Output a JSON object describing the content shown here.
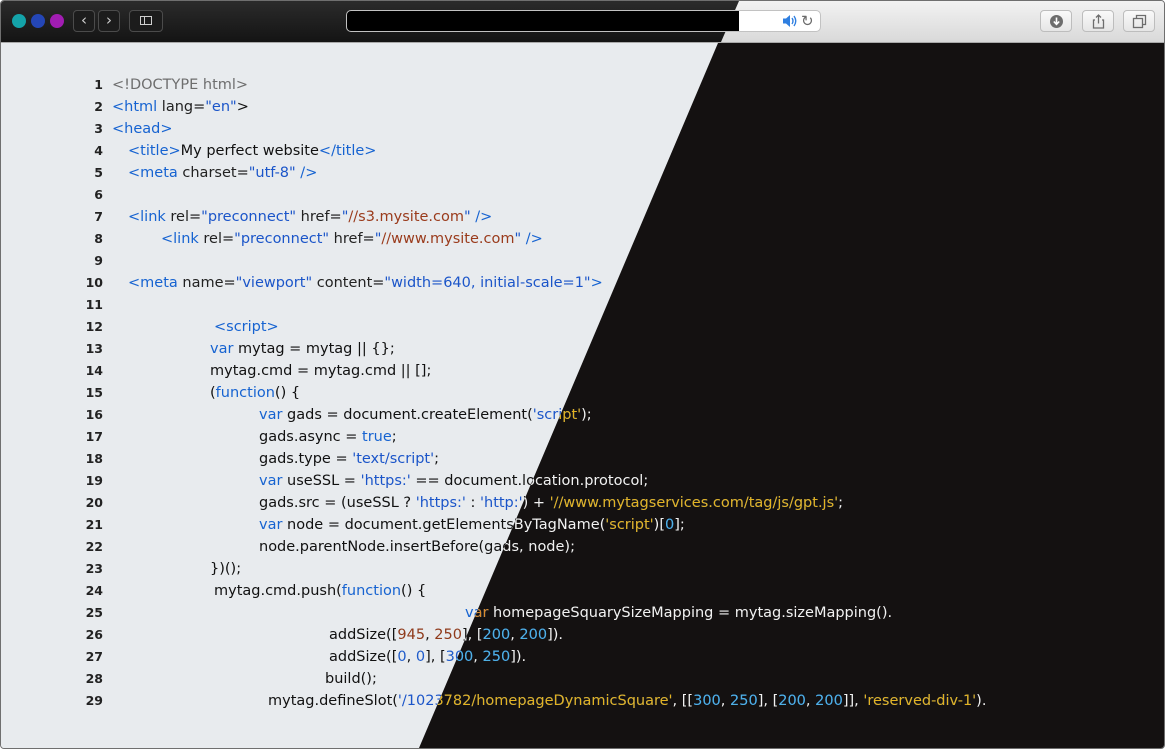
{
  "toolbar": {
    "traffic_lights": [
      {
        "name": "close",
        "color": "#14a3a9"
      },
      {
        "name": "minimize",
        "color": "#2446b6"
      },
      {
        "name": "zoom",
        "color": "#a21db3"
      }
    ],
    "back_glyph": "‹",
    "forward_glyph": "›",
    "reload_glyph": "↻",
    "icons": [
      "sidebar-icon",
      "speaker-icon",
      "reload-icon",
      "download-icon",
      "share-icon",
      "tabs-icon"
    ]
  },
  "theme": {
    "light_background": "#e8ebee",
    "dark_background": "#141111"
  },
  "code_lines": [
    {
      "num": "1",
      "indent": 111,
      "tokens": [
        [
          "c-doc",
          "<!DOCTYPE html>"
        ]
      ]
    },
    {
      "num": "2",
      "indent": 111,
      "tokens": [
        [
          "c-tag",
          "<html"
        ],
        [
          "c-attr",
          " lang"
        ],
        [
          "c-pun",
          "="
        ],
        [
          "c-val",
          "\"en\""
        ],
        [
          "c-pun",
          ">"
        ]
      ]
    },
    {
      "num": "3",
      "indent": 111,
      "tokens": [
        [
          "c-tag",
          "<head>"
        ]
      ]
    },
    {
      "num": "4",
      "indent": 127,
      "tokens": [
        [
          "c-tag",
          "<title>"
        ],
        [
          "c-txt",
          "My perfect website"
        ],
        [
          "c-tag",
          "</title>"
        ]
      ]
    },
    {
      "num": "5",
      "indent": 127,
      "tokens": [
        [
          "c-tag",
          "<meta"
        ],
        [
          "c-attr",
          " charset"
        ],
        [
          "c-pun",
          "="
        ],
        [
          "c-val",
          "\"utf-8\""
        ],
        [
          "c-tag",
          " />"
        ]
      ]
    },
    {
      "num": "6",
      "indent": 127,
      "tokens": []
    },
    {
      "num": "7",
      "indent": 127,
      "tokens": [
        [
          "c-tag",
          "<link"
        ],
        [
          "c-attr",
          " rel"
        ],
        [
          "c-pun",
          "="
        ],
        [
          "c-val",
          "\"preconnect\""
        ],
        [
          "c-attr",
          " href"
        ],
        [
          "c-pun",
          "="
        ],
        [
          "c-val",
          "\""
        ],
        [
          "c-url",
          "//s3.mysite.com"
        ],
        [
          "c-val",
          "\""
        ],
        [
          "c-tag",
          " />"
        ]
      ]
    },
    {
      "num": "8",
      "indent": 160,
      "tokens": [
        [
          "c-tag",
          "<link"
        ],
        [
          "c-attr",
          " rel"
        ],
        [
          "c-pun",
          "="
        ],
        [
          "c-val",
          "\"preconnect\""
        ],
        [
          "c-attr",
          " href"
        ],
        [
          "c-pun",
          "="
        ],
        [
          "c-val",
          "\""
        ],
        [
          "c-url",
          "//www.mysite.com"
        ],
        [
          "c-val",
          "\""
        ],
        [
          "c-tag",
          " />"
        ]
      ]
    },
    {
      "num": "9",
      "indent": 127,
      "tokens": []
    },
    {
      "num": "10",
      "indent": 127,
      "tokens": [
        [
          "c-tag",
          "<meta"
        ],
        [
          "c-attr",
          " name"
        ],
        [
          "c-pun",
          "="
        ],
        [
          "c-val",
          "\"viewport\""
        ],
        [
          "c-attr",
          " content"
        ],
        [
          "c-pun",
          "="
        ],
        [
          "c-val",
          "\"width=640, initial-scale=1\""
        ],
        [
          "c-tag",
          ">"
        ]
      ]
    },
    {
      "num": "11",
      "indent": 127,
      "tokens": []
    },
    {
      "num": "12",
      "indent": 213,
      "tokens": [
        [
          "c-tag",
          "<script>"
        ]
      ]
    },
    {
      "num": "13",
      "indent": 209,
      "tokens": [
        [
          "c-kw",
          "var"
        ],
        [
          "c-txt",
          " mytag = mytag || {};"
        ]
      ]
    },
    {
      "num": "14",
      "indent": 209,
      "tokens": [
        [
          "c-txt",
          "mytag.cmd = mytag.cmd || [];"
        ]
      ]
    },
    {
      "num": "15",
      "indent": 209,
      "tokens": [
        [
          "c-txt",
          "("
        ],
        [
          "c-kw",
          "function"
        ],
        [
          "c-txt",
          "() {"
        ]
      ]
    },
    {
      "num": "16",
      "indent": 258,
      "tokens": [
        [
          "c-kw",
          "var"
        ],
        [
          "c-txt",
          " gads = document.createElement("
        ],
        [
          "c-str",
          "'script'"
        ],
        [
          "c-txt",
          ");"
        ]
      ]
    },
    {
      "num": "17",
      "indent": 258,
      "tokens": [
        [
          "c-txt",
          "gads.async = "
        ],
        [
          "c-kw",
          "true"
        ],
        [
          "c-txt",
          ";"
        ]
      ]
    },
    {
      "num": "18",
      "indent": 258,
      "tokens": [
        [
          "c-txt",
          "gads.type = "
        ],
        [
          "c-str",
          "'text/script'"
        ],
        [
          "c-txt",
          ";"
        ]
      ]
    },
    {
      "num": "19",
      "indent": 258,
      "tokens": [
        [
          "c-kw",
          "var"
        ],
        [
          "c-txt",
          " useSSL = "
        ],
        [
          "c-str",
          "'https:'"
        ],
        [
          "c-txt",
          " == document.location.protocol;"
        ]
      ]
    },
    {
      "num": "20",
      "indent": 258,
      "tokens": [
        [
          "c-txt",
          "gads.src = (useSSL ? "
        ],
        [
          "c-str",
          "'https:'"
        ],
        [
          "c-txt",
          " : "
        ],
        [
          "c-str",
          "'http:'"
        ],
        [
          "c-txt",
          ") + "
        ],
        [
          "c-str",
          "'//www.mytagservices.com/tag/js/gpt.js'"
        ],
        [
          "c-txt",
          ";"
        ]
      ]
    },
    {
      "num": "21",
      "indent": 258,
      "tokens": [
        [
          "c-kw",
          "var"
        ],
        [
          "c-txt",
          " node = document.getElementsByTagName("
        ],
        [
          "c-str",
          "'script'"
        ],
        [
          "c-txt",
          ")["
        ],
        [
          "c-num2",
          "0"
        ],
        [
          "c-txt",
          "];"
        ]
      ]
    },
    {
      "num": "22",
      "indent": 258,
      "tokens": [
        [
          "c-txt",
          "node.parentNode.insertBefore(gads, node);"
        ]
      ]
    },
    {
      "num": "23",
      "indent": 209,
      "tokens": [
        [
          "c-txt",
          "})();"
        ]
      ]
    },
    {
      "num": "24",
      "indent": 213,
      "tokens": [
        [
          "c-txt",
          "mytag.cmd.push("
        ],
        [
          "c-kw",
          "function"
        ],
        [
          "c-txt",
          "() {"
        ]
      ]
    },
    {
      "num": "25",
      "indent": 464,
      "tokens": [
        [
          "c-kw",
          "var"
        ],
        [
          "c-txt",
          " homepageSquarySizeMapping = mytag.sizeMapping()."
        ]
      ]
    },
    {
      "num": "26",
      "indent": 328,
      "tokens": [
        [
          "c-txt",
          "addSize(["
        ],
        [
          "c-num",
          "945"
        ],
        [
          "c-txt",
          ", "
        ],
        [
          "c-num",
          "250"
        ],
        [
          "c-txt",
          "], ["
        ],
        [
          "c-num2",
          "200"
        ],
        [
          "c-txt",
          ", "
        ],
        [
          "c-num2",
          "200"
        ],
        [
          "c-txt",
          "])."
        ]
      ]
    },
    {
      "num": "27",
      "indent": 328,
      "tokens": [
        [
          "c-txt",
          "addSize(["
        ],
        [
          "c-num2",
          "0"
        ],
        [
          "c-txt",
          ", "
        ],
        [
          "c-num2",
          "0"
        ],
        [
          "c-txt",
          "], ["
        ],
        [
          "c-num2",
          "300"
        ],
        [
          "c-txt",
          ", "
        ],
        [
          "c-num2",
          "250"
        ],
        [
          "c-txt",
          "])."
        ]
      ]
    },
    {
      "num": "28",
      "indent": 324,
      "tokens": [
        [
          "c-txt",
          "build();"
        ]
      ]
    },
    {
      "num": "29",
      "indent": 267,
      "tokens": [
        [
          "c-txt",
          "mytag.defineSlot("
        ],
        [
          "c-str",
          "'/1023782/homepageDynamicSquare'"
        ],
        [
          "c-txt",
          ", [["
        ],
        [
          "c-num2",
          "300"
        ],
        [
          "c-txt",
          ", "
        ],
        [
          "c-num2",
          "250"
        ],
        [
          "c-txt",
          "], ["
        ],
        [
          "c-num2",
          "200"
        ],
        [
          "c-txt",
          ", "
        ],
        [
          "c-num2",
          "200"
        ],
        [
          "c-txt",
          "]], "
        ],
        [
          "c-str",
          "'reserved-div-1'"
        ],
        [
          "c-txt",
          ")."
        ]
      ]
    }
  ]
}
